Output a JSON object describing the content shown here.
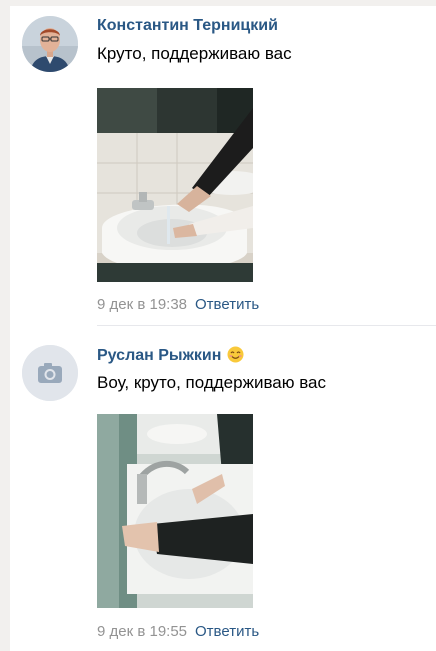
{
  "comments": [
    {
      "author": "Константин Терницкий",
      "text": "Круто, поддерживаю вас",
      "date": "9 дек в 19:38",
      "reply_label": "Ответить",
      "avatar": "user-photo"
    },
    {
      "author": "Руслан Рыжкин",
      "text": "Воу, круто, поддерживаю вас",
      "date": "9 дек в 19:55",
      "reply_label": "Ответить",
      "avatar": "camera-placeholder-icon",
      "emoji": "smiling-face-emoji"
    }
  ],
  "colors": {
    "link": "#2a5885",
    "meta": "#939393",
    "page_bg": "#f2f0ee"
  }
}
